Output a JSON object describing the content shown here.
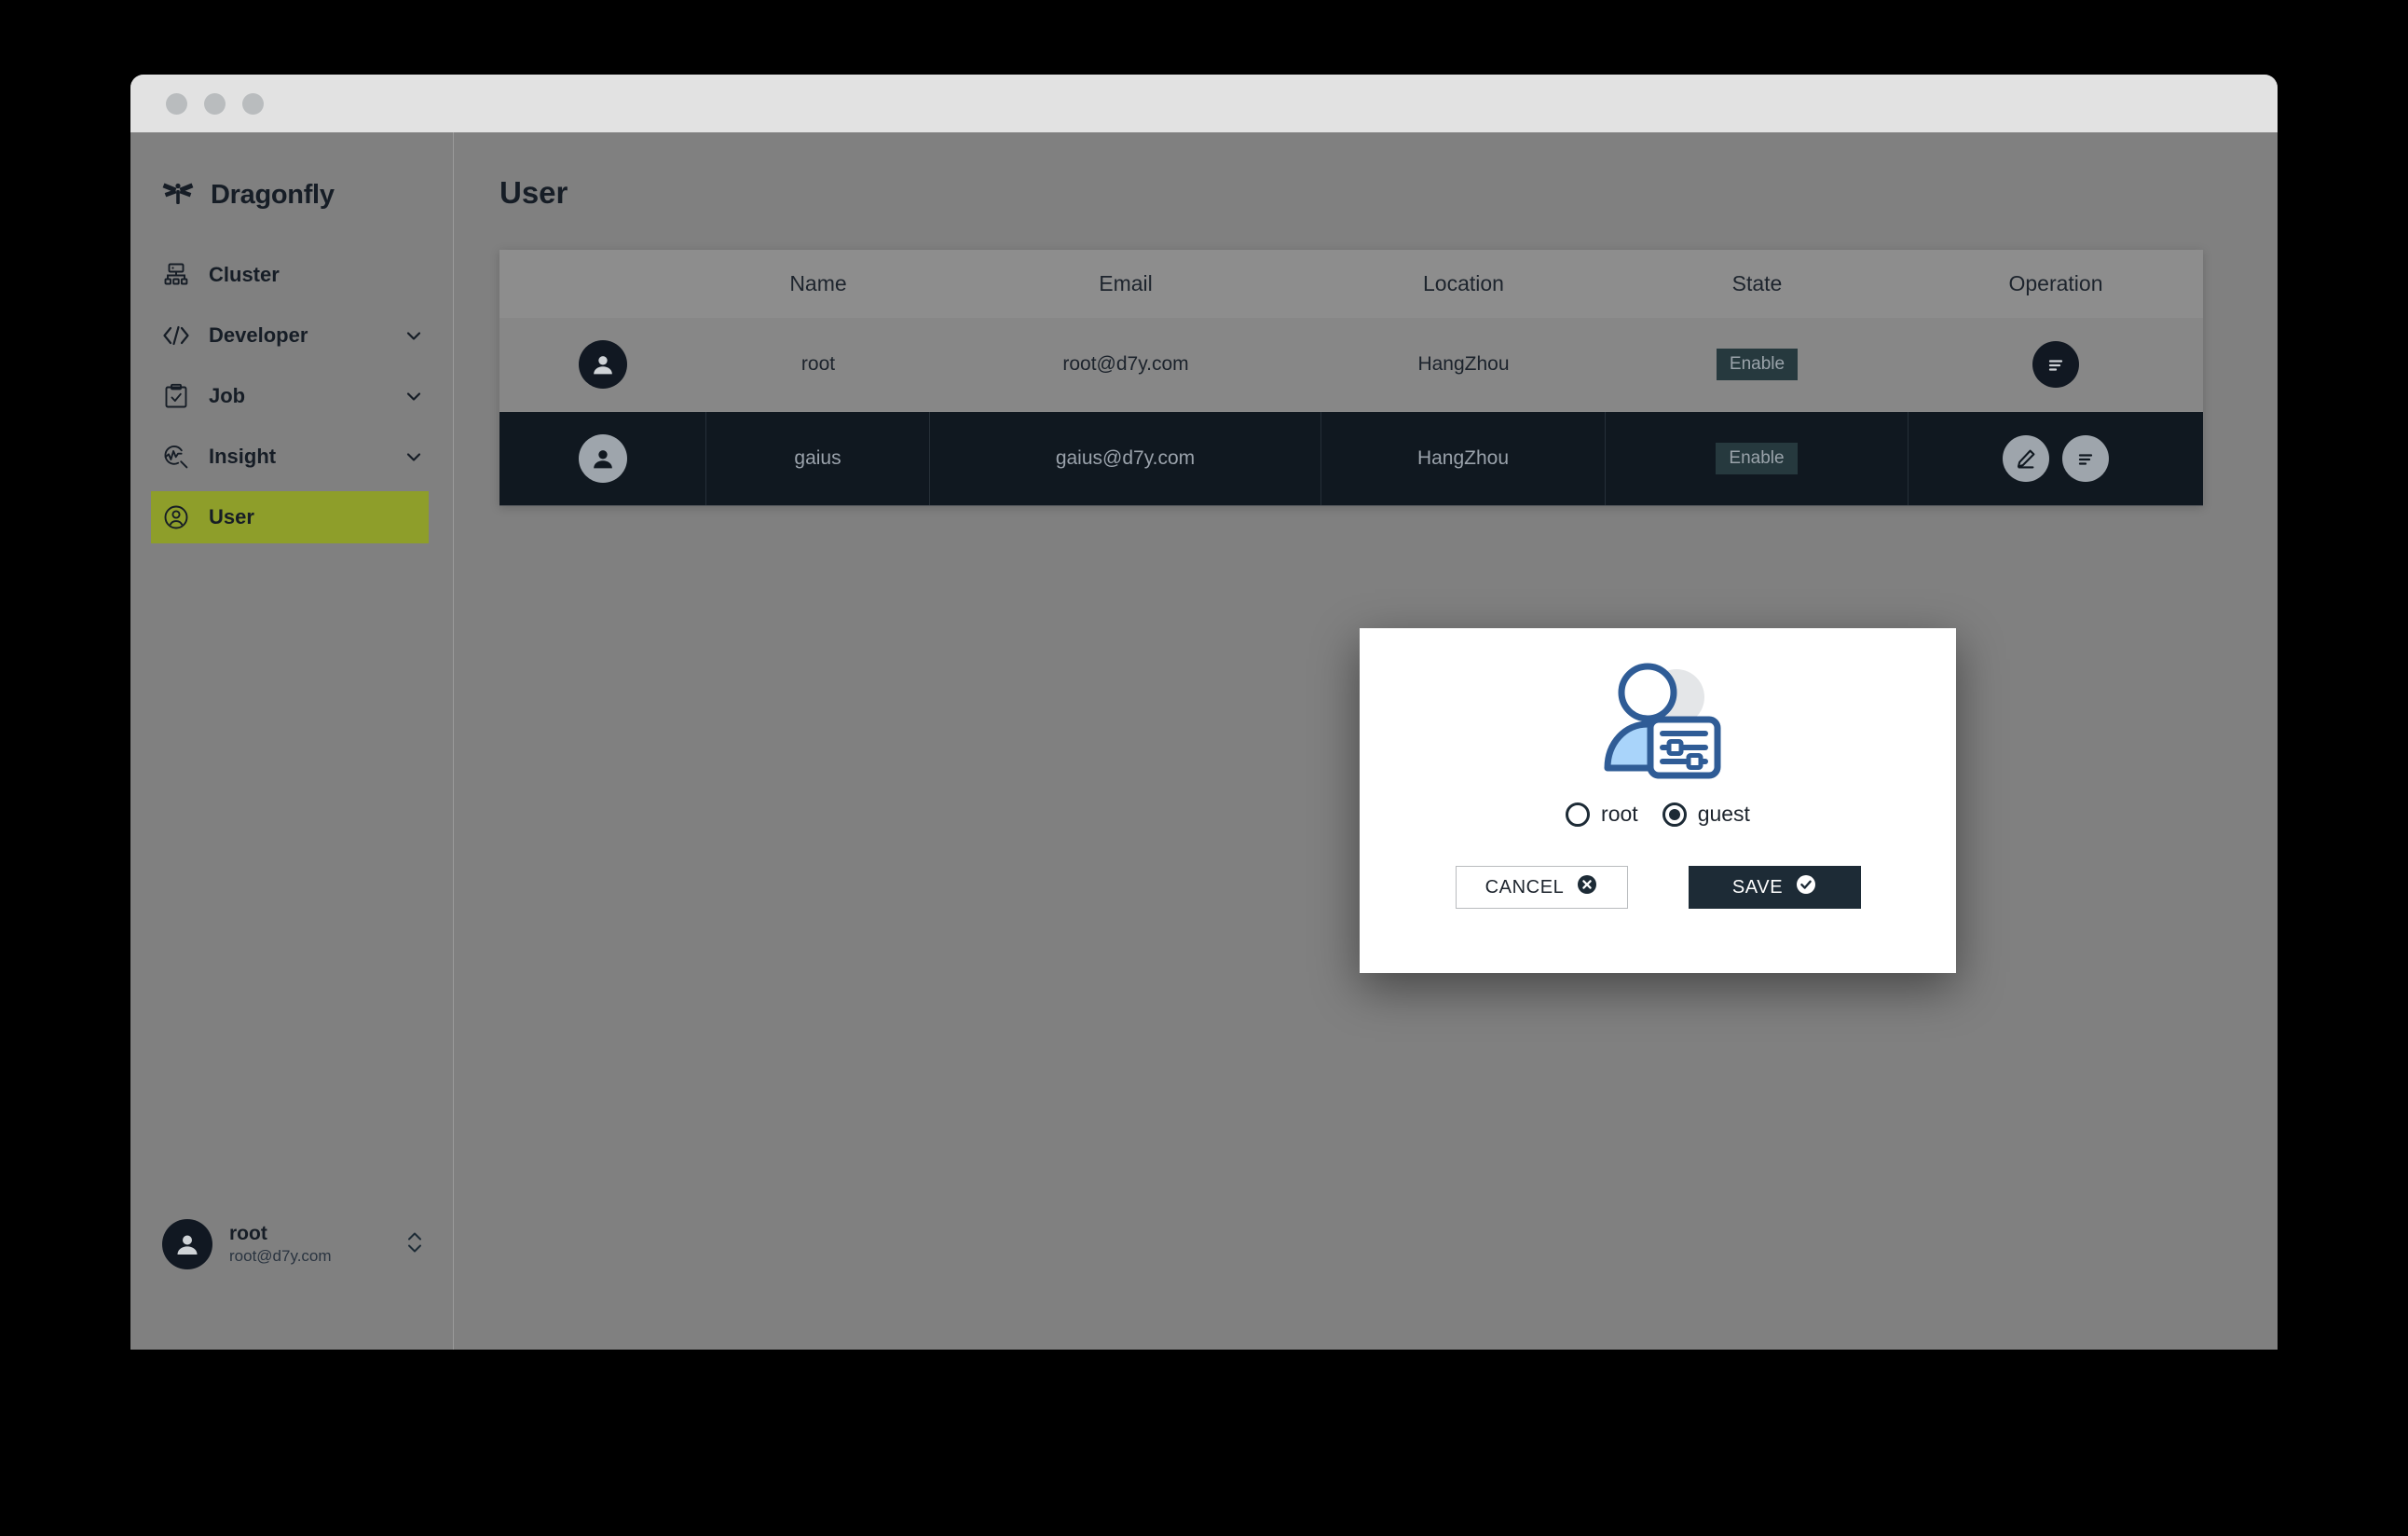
{
  "window": {
    "traffic_lights": [
      "close",
      "minimize",
      "maximize"
    ]
  },
  "sidebar": {
    "brand": "Dragonfly",
    "brand_icon": "dragonfly-logo-icon",
    "items": [
      {
        "label": "Cluster",
        "icon": "cluster-icon",
        "expandable": false,
        "active": false
      },
      {
        "label": "Developer",
        "icon": "code-icon",
        "expandable": true,
        "active": false
      },
      {
        "label": "Job",
        "icon": "clipboard-check-icon",
        "expandable": true,
        "active": false
      },
      {
        "label": "Insight",
        "icon": "insight-search-icon",
        "expandable": true,
        "active": false
      },
      {
        "label": "User",
        "icon": "user-circle-icon",
        "expandable": false,
        "active": true
      }
    ],
    "profile": {
      "name": "root",
      "email": "root@d7y.com",
      "avatar_icon": "avatar-icon",
      "selector_icon": "chevron-up-down-icon"
    },
    "active_color": "#8e9e2a"
  },
  "main": {
    "title": "User",
    "table": {
      "columns": [
        "",
        "Name",
        "Email",
        "Location",
        "State",
        "Operation"
      ],
      "rows": [
        {
          "avatar_icon": "avatar-icon",
          "name": "root",
          "email": "root@d7y.com",
          "location": "HangZhou",
          "state": "Enable",
          "selected": false,
          "operations": [
            "list-icon"
          ]
        },
        {
          "avatar_icon": "avatar-icon",
          "name": "gaius",
          "email": "gaius@d7y.com",
          "location": "HangZhou",
          "state": "Enable",
          "selected": true,
          "operations": [
            "edit-pencil-icon",
            "list-icon"
          ]
        }
      ]
    }
  },
  "modal": {
    "illustration_icon": "user-settings-illustration",
    "options": [
      {
        "label": "root",
        "selected": false
      },
      {
        "label": "guest",
        "selected": true
      }
    ],
    "cancel_label": "CANCEL",
    "cancel_icon": "circle-x-icon",
    "save_label": "SAVE",
    "save_icon": "circle-check-icon",
    "accent_dark": "#1d2b36",
    "illustration_blue": "#a9d4fa",
    "illustration_outline": "#2f5c96"
  }
}
